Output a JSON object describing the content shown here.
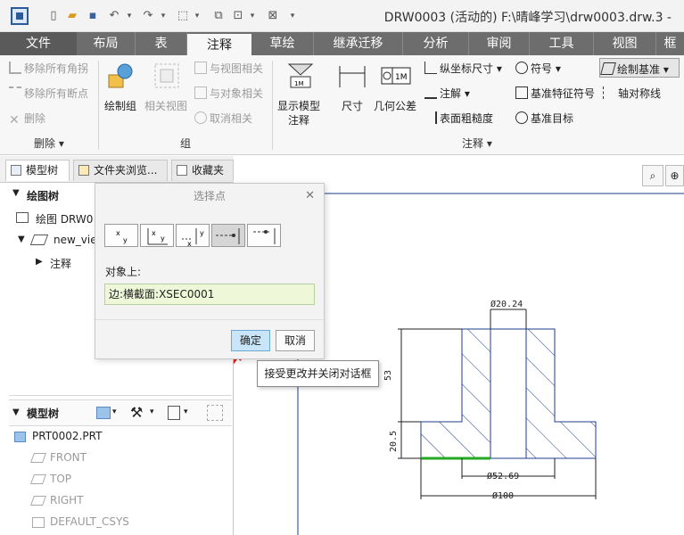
{
  "titlebar": {
    "title": "DRW0003 (活动的) F:\\晴峰学习\\drw0003.drw.3 -"
  },
  "tabs": [
    {
      "label": "文件"
    },
    {
      "label": "布局"
    },
    {
      "label": "表"
    },
    {
      "label": "注释"
    },
    {
      "label": "草绘"
    },
    {
      "label": "继承迁移"
    },
    {
      "label": "分析"
    },
    {
      "label": "审阅"
    },
    {
      "label": "工具"
    },
    {
      "label": "视图"
    },
    {
      "label": "框"
    }
  ],
  "ribbon": {
    "delete_group": {
      "remove_all_angles": "移除所有角拐",
      "remove_all_breaks": "移除所有断点",
      "delete": "删除",
      "label": "删除 ▾"
    },
    "group_group": {
      "draw_group": "绘制组",
      "related_view": "相关视图",
      "related_to_view": "与视图相关",
      "related_to_object": "与对象相关",
      "cancel_related": "取消相关",
      "label": "组"
    },
    "annotation_group": {
      "show_model_annotation_1": "显示模型",
      "show_model_annotation_2": "注释",
      "dimension": "尺寸",
      "geometric_tolerance": "几何公差",
      "ordinate_dimension": "纵坐标尺寸 ▾",
      "note": "注解 ▾",
      "surface_finish": "表面粗糙度",
      "symbol": "符号 ▾",
      "datum_feature_symbol": "基准特征符号",
      "datum_target": "基准目标",
      "draw_datum": "绘制基准 ▾",
      "axis_symmetry": "轴对称线",
      "label": "注释 ▾"
    }
  },
  "left_tabs": [
    {
      "label": "模型树"
    },
    {
      "label": "文件夹浏览..."
    },
    {
      "label": "收藏夹"
    }
  ],
  "drawing_tree": {
    "header": "绘图树",
    "items": [
      "绘图 DRW0",
      "new_vie",
      "注释"
    ]
  },
  "model_tree": {
    "header": "模型树",
    "items": [
      "PRT0002.PRT",
      "FRONT",
      "TOP",
      "RIGHT",
      "DEFAULT_CSYS"
    ]
  },
  "dialog": {
    "title": "选择点",
    "label": "对象上:",
    "field_value": "边:横截面:XSEC0001",
    "ok": "确定",
    "cancel": "取消"
  },
  "tooltip": "接受更改并关闭对话框",
  "drawing": {
    "dim_top": "Ø20.24",
    "dim_53": "53",
    "dim_20_5": "20.5",
    "dim_52": "Ø52.69",
    "dim_100": "Ø100"
  },
  "colors": {
    "accent": "#6d6d6d",
    "part_line": "#1e3c8c",
    "highlight": "#22aa22"
  }
}
